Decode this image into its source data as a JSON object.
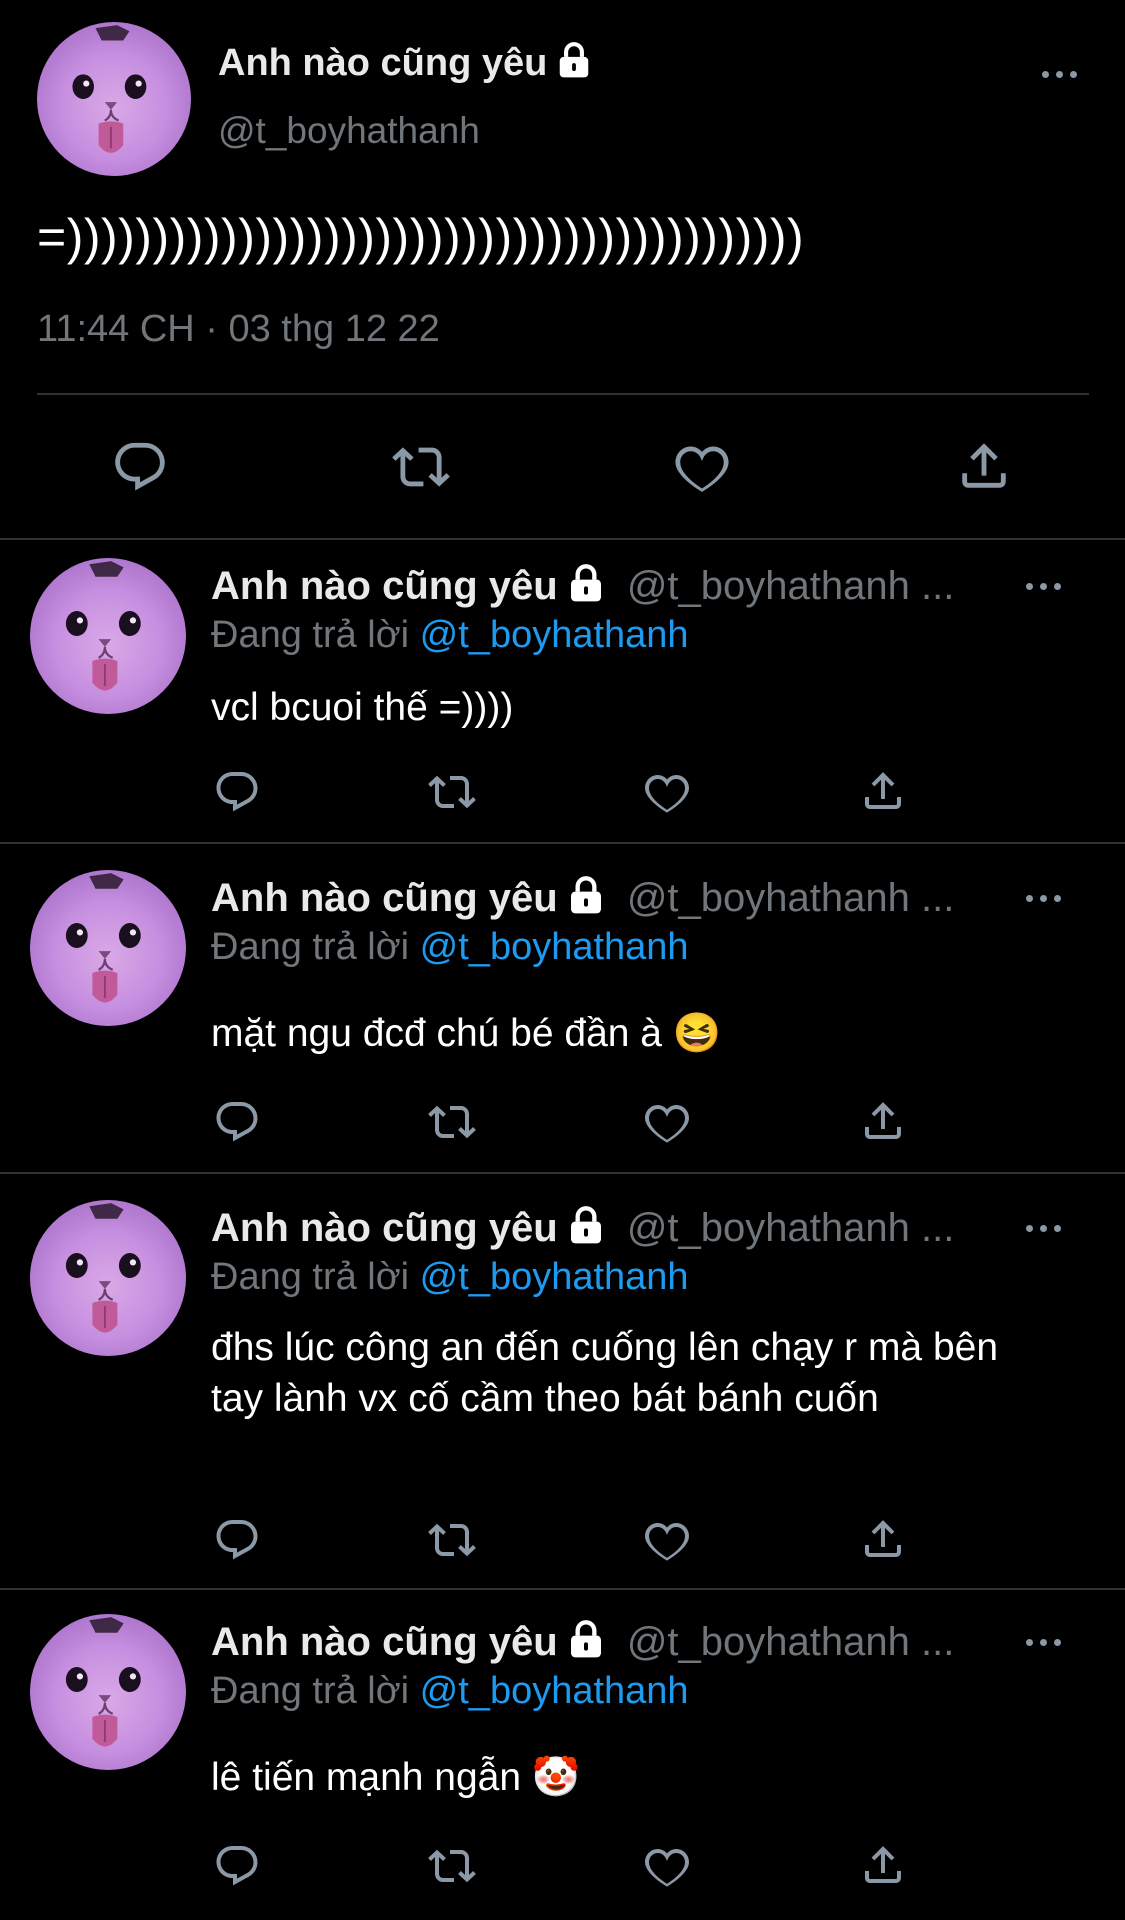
{
  "main_tweet": {
    "display_name": "Anh nào cũng yêu",
    "handle": "@t_boyhathanh",
    "text": "=)))))))))))))))))))))))))))))))))))))))))))",
    "timestamp": "11:44 CH · 03 thg 12 22",
    "icons": [
      "lock-icon",
      "more-icon",
      "reply-icon",
      "retweet-icon",
      "like-icon",
      "share-icon"
    ]
  },
  "replies": [
    {
      "display_name": "Anh nào cũng yêu",
      "handle": "@t_boyhathanh ...",
      "replying_prefix": "Đang trả lời",
      "replying_to": "@t_boyhathanh",
      "text": "vcl bcuoi thế =))))"
    },
    {
      "display_name": "Anh nào cũng yêu",
      "handle": "@t_boyhathanh ...",
      "replying_prefix": "Đang trả lời",
      "replying_to": "@t_boyhathanh",
      "text": "mặt ngu đcđ chú bé đần à 😆"
    },
    {
      "display_name": "Anh nào cũng yêu",
      "handle": "@t_boyhathanh ...",
      "replying_prefix": "Đang trả lời",
      "replying_to": "@t_boyhathanh",
      "text": "đhs lúc công an đến cuống lên chạy r mà bên tay lành vx cố cầm theo bát bánh cuốn"
    },
    {
      "display_name": "Anh nào cũng yêu",
      "handle": "@t_boyhathanh ...",
      "replying_prefix": "Đang trả lời",
      "replying_to": "@t_boyhathanh",
      "text": "lê tiến mạnh ngẫn 🤡"
    }
  ],
  "colors": {
    "background": "#000000",
    "text": "#e7e9ea",
    "secondary": "#71767b",
    "link": "#1d9bf0",
    "divider": "#2f3336",
    "icon": "#8b98a5"
  }
}
